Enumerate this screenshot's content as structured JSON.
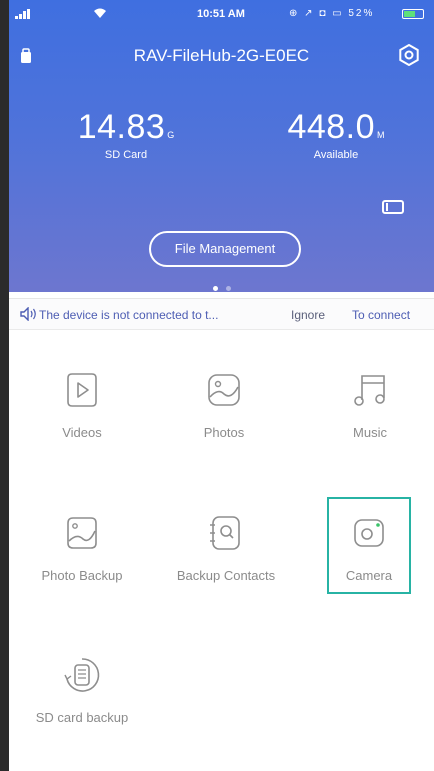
{
  "status_bar": {
    "time": "10:51 AM",
    "indicators": "⊕ ↗ ◘ ▭ 52%"
  },
  "header": {
    "device_name": "RAV-FileHub-2G-E0EC",
    "sd_card": {
      "value": "14.83",
      "unit": "G",
      "label": "SD Card"
    },
    "available": {
      "value": "448.0",
      "unit": "M",
      "label": "Available"
    },
    "file_management_label": "File Management",
    "page_indicator": {
      "count": 2,
      "active": 0
    }
  },
  "notice": {
    "message": "The device is not connected to t...",
    "ignore_label": "Ignore",
    "connect_label": "To connect"
  },
  "features": [
    {
      "label": "Videos",
      "icon": "play-icon"
    },
    {
      "label": "Photos",
      "icon": "photo-icon"
    },
    {
      "label": "Music",
      "icon": "music-icon"
    },
    {
      "label": "Photo Backup",
      "icon": "photo-backup-icon"
    },
    {
      "label": "Backup Contacts",
      "icon": "contacts-icon"
    },
    {
      "label": "Camera",
      "icon": "camera-icon"
    },
    {
      "label": "SD card backup",
      "icon": "sd-card-backup-icon"
    }
  ],
  "colors": {
    "header_top": "#3f6fe0",
    "header_bottom": "#6d76cf",
    "highlight": "#27b3a4",
    "icon_stroke": "#8e8e8e"
  }
}
